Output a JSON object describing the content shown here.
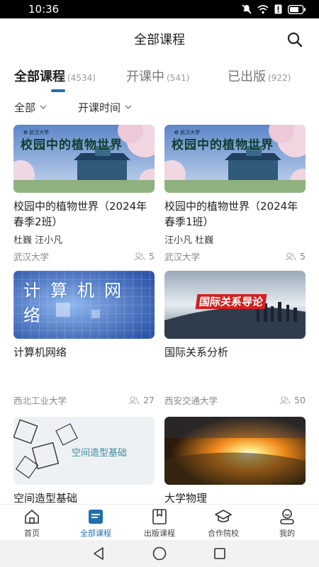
{
  "status_bar": {
    "time": "10:36"
  },
  "header": {
    "title": "全部课程",
    "search_icon": "search-icon"
  },
  "tabs": [
    {
      "label": "全部课程",
      "count": "(4534)",
      "active": true
    },
    {
      "label": "开课中",
      "count": "(541)",
      "active": false
    },
    {
      "label": "已出版",
      "count": "(922)",
      "active": false
    }
  ],
  "filters": [
    {
      "label": "全部",
      "icon": "chevron-down-icon"
    },
    {
      "label": "开课时间",
      "icon": "chevron-down-icon"
    }
  ],
  "courses": [
    {
      "title": "校园中的植物世界（2024年春季2班）",
      "teachers": "杜巍 汪小凡",
      "school": "武汉大学",
      "students": "5",
      "thumb_text": "校园中的植物世界"
    },
    {
      "title": "校园中的植物世界（2024年春季1班）",
      "teachers": "汪小凡 杜巍",
      "school": "武汉大学",
      "students": "5",
      "thumb_text": "校园中的植物世界"
    },
    {
      "title": "计算机网络",
      "teachers": "",
      "school": "西北工业大学",
      "students": "27",
      "thumb_text": "计算机网络"
    },
    {
      "title": "国际关系分析",
      "teachers": "",
      "school": "西安交通大学",
      "students": "50",
      "thumb_text": "国际关系导论"
    },
    {
      "title": "空间造型基础",
      "teachers": "",
      "school": "",
      "students": "",
      "thumb_text": "空间造型基础"
    },
    {
      "title": "大学物理",
      "teachers": "",
      "school": "",
      "students": "",
      "thumb_text": ""
    }
  ],
  "bottom_nav": [
    {
      "label": "首页",
      "icon": "home-icon",
      "active": false
    },
    {
      "label": "全部课程",
      "icon": "courses-icon",
      "active": true
    },
    {
      "label": "出版课程",
      "icon": "book-icon",
      "active": false
    },
    {
      "label": "合作院校",
      "icon": "graduation-cap-icon",
      "active": false
    },
    {
      "label": "我的",
      "icon": "profile-icon",
      "active": false
    }
  ],
  "colors": {
    "accent": "#1f6fb2",
    "text": "#222222",
    "muted": "#888888"
  }
}
